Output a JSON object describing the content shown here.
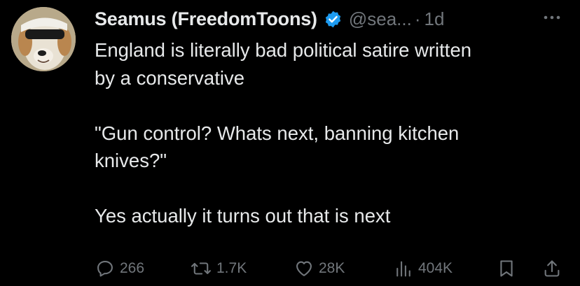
{
  "tweet": {
    "display_name": "Seamus (FreedomToons)",
    "handle": "@sea...",
    "separator": "·",
    "time": "1d",
    "body_lines": [
      "England is literally bad political satire written",
      "by a conservative",
      "",
      "\"Gun control?  Whats next, banning kitchen",
      "knives?\"",
      "",
      "Yes actually it turns out that is next"
    ]
  },
  "icons": {
    "verified": "verified-badge-icon",
    "more": "more-dots-icon",
    "reply": "reply-icon",
    "retweet": "retweet-icon",
    "like": "heart-icon",
    "views": "views-chart-icon",
    "bookmark": "bookmark-icon",
    "share": "share-icon"
  },
  "actions": {
    "replies": "266",
    "reposts": "1.7K",
    "likes": "28K",
    "views": "404K"
  },
  "colors": {
    "background": "#000000",
    "text": "#e7e9ea",
    "muted": "#71767b",
    "verified": "#1d9bf0"
  }
}
